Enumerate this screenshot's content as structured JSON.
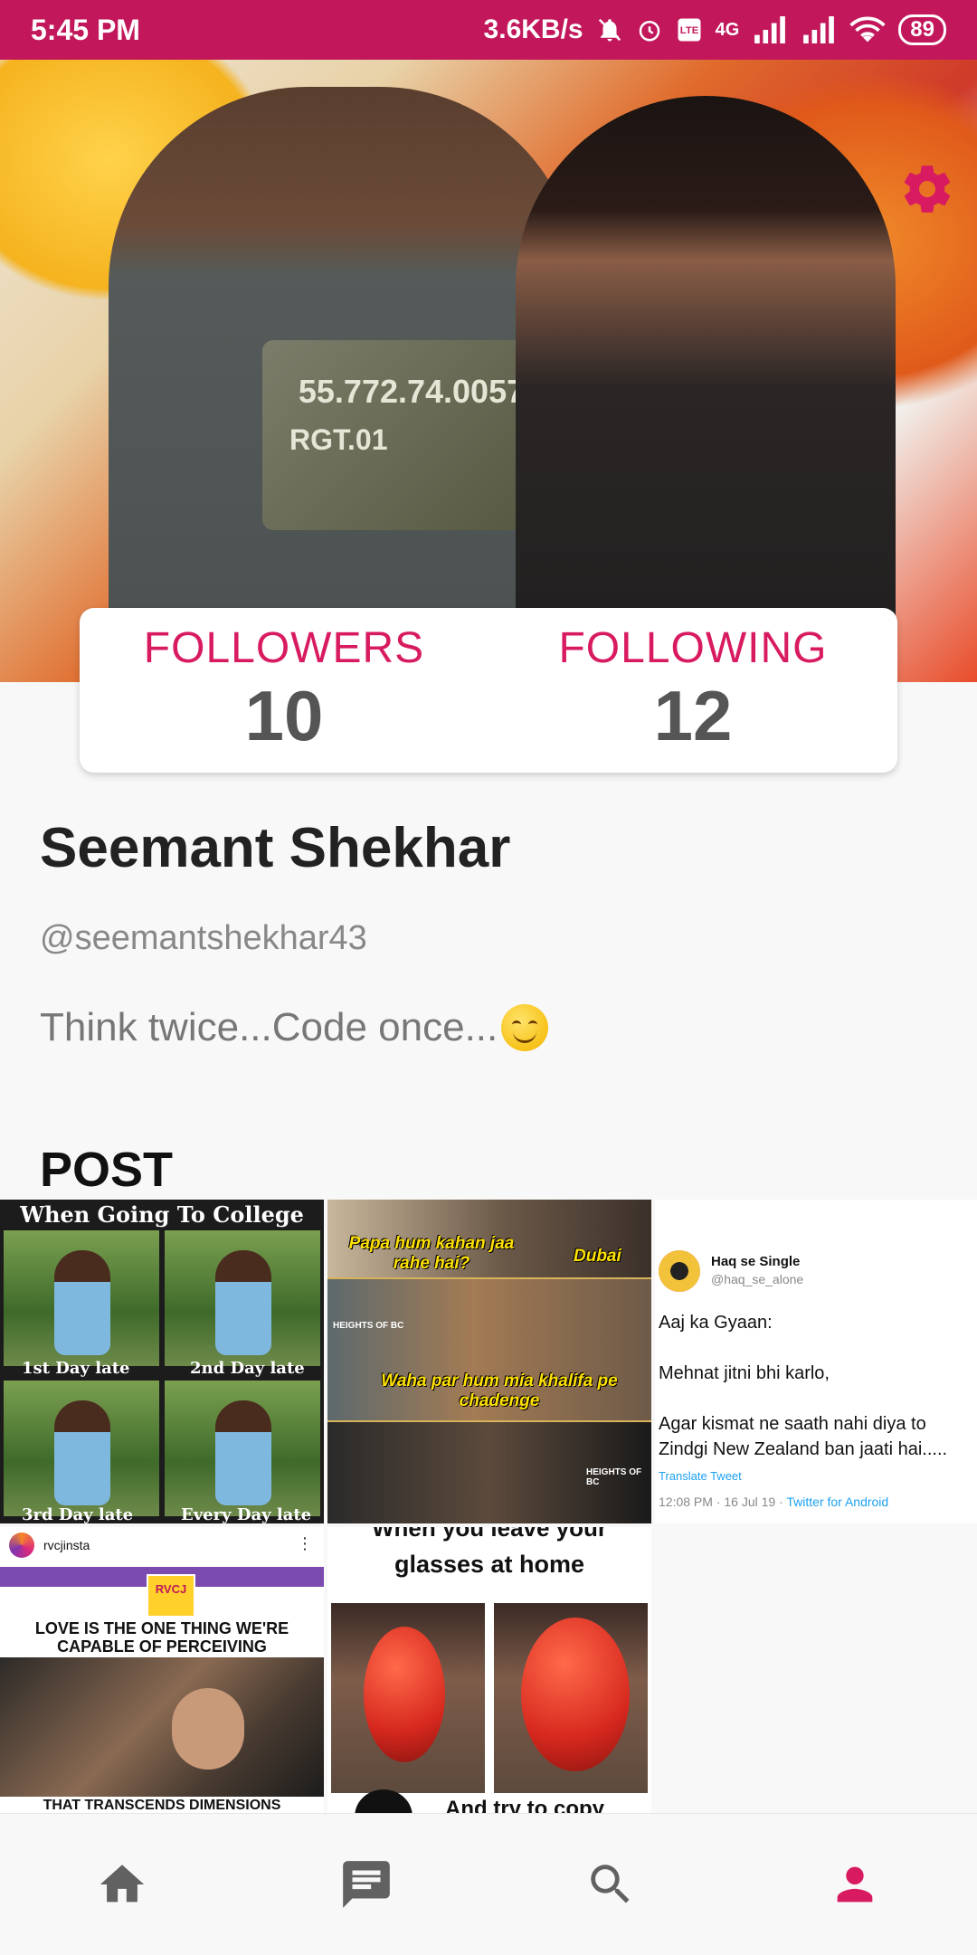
{
  "status_bar": {
    "time": "5:45 PM",
    "speed": "3.6KB/s",
    "network": "4G",
    "volte": "VoLTE",
    "battery": "89"
  },
  "profile": {
    "followers_label": "FOLLOWERS",
    "followers_count": "10",
    "following_label": "FOLLOWING",
    "following_count": "12",
    "name": "Seemant Shekhar",
    "handle": "@seemantshekhar43",
    "bio": "Think twice...Code once...",
    "bio_emoji": "smiling-face-icon",
    "section_title": "POST"
  },
  "cover_shirt_text": [
    "55.772.74.0057",
    "RGT.01"
  ],
  "posts": {
    "post1": {
      "caption": "When Going To College",
      "labels": [
        "1st Day late",
        "2nd Day late",
        "3rd Day late",
        "Every Day late"
      ]
    },
    "post2": {
      "line1": "Papa hum kahan jaa rahe hai?",
      "line2": "Dubai",
      "line3": "Waha par hum mia khalifa pe chadenge",
      "watermark": "HEIGHTS OF BC"
    },
    "post3": {
      "name": "Haq se Single",
      "handle": "@haq_se_alone",
      "body": "Aaj ka Gyaan:\n\nMehnat jitni bhi karlo,\n\nAgar kismat ne saath nahi diya to Zindgi New Zealand ban jaati hai.....",
      "translate": "Translate Tweet",
      "meta_time": "12:08 PM · 16 Jul 19 · ",
      "meta_source": "Twitter for Android"
    },
    "post4": {
      "username": "rvcjinsta",
      "logo": "RVCJ",
      "quote": "LOVE IS THE ONE THING WE'RE CAPABLE OF PERCEIVING",
      "footer": "THAT TRANSCENDS DIMENSIONS"
    },
    "post5": {
      "caption_top": "When you leave your",
      "caption_main": "glasses at home",
      "caption_bottom": "And try to copy"
    }
  },
  "nav": {
    "home_icon": "home-icon",
    "chat_icon": "chat-icon",
    "search_icon": "search-icon",
    "profile_icon": "profile-icon",
    "active": "profile",
    "accent": "#d81b60",
    "inactive": "#616161"
  }
}
